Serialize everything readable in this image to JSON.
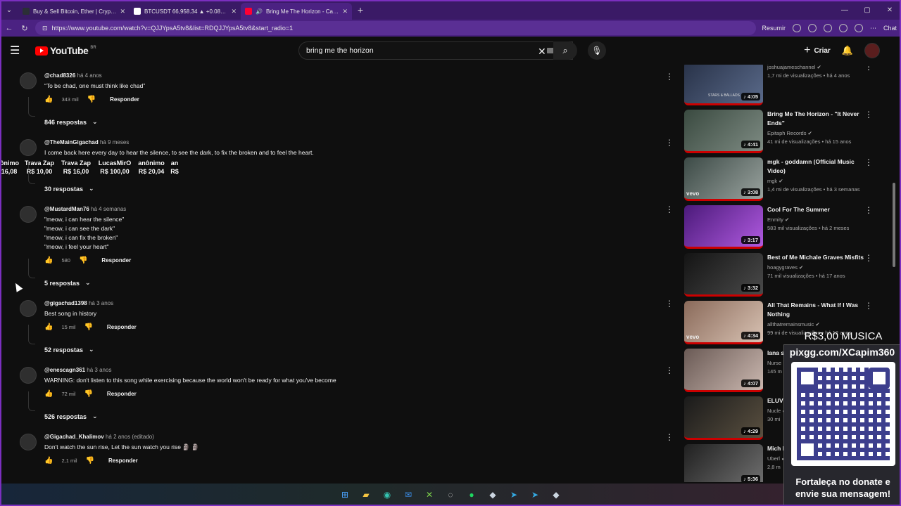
{
  "tabs": [
    {
      "label": "Buy & Sell Bitcoin, Ether | Cryptoc",
      "fav_color": "#2b2f36"
    },
    {
      "label": "BTCUSDT 66,958.34 ▲ +0.08% Unna",
      "fav_color": "#ffffff"
    },
    {
      "label": "Bring Me The Horizon - Can You",
      "fav_color": "#ff0033"
    }
  ],
  "address": {
    "url": "https://www.youtube.com/watch?v=QJJYpsA5tv8&list=RDQJJYpsA5tv8&start_radio=1",
    "resumir": "Resumir",
    "chat": "Chat"
  },
  "header": {
    "logo": "YouTube",
    "country": "BR",
    "search_value": "bring me the horizon",
    "create": "Criar"
  },
  "comments": [
    {
      "user": "@chad8326",
      "time": "há 4 anos",
      "text": [
        "“To be chad, one must think like chad”"
      ],
      "likes": "343 mil",
      "reply": "Responder",
      "replies": "846 respostas"
    },
    {
      "user": "@TheMainGigachad",
      "time": "há 9 meses",
      "text": [
        "I come back here every day to hear the silence, to see the dark, to fix the broken and to feel the heart."
      ],
      "likes": "",
      "reply": "",
      "replies": "30 respostas"
    },
    {
      "user": "@MustardMan76",
      "time": "há 4 semanas",
      "text": [
        "\"meow, i can hear the silence\"",
        "\"meow, i can see the dark\"",
        "\"meow, i can fix the broken\"",
        "\"meow, i feel your heart\""
      ],
      "likes": "580",
      "reply": "Responder",
      "replies": "5 respostas"
    },
    {
      "user": "@gigachad1398",
      "time": "há 3 anos",
      "text": [
        "Best song in history"
      ],
      "likes": "15 mil",
      "reply": "Responder",
      "replies": "52 respostas"
    },
    {
      "user": "@enescagn361",
      "time": "há 3 anos",
      "text": [
        "WARNING: don't listen to this song while exercising because the world won't be ready for what you've become"
      ],
      "likes": "72 mil",
      "reply": "Responder",
      "replies": "526 respostas"
    },
    {
      "user": "@Gigachad_Khalimov",
      "time": "há 2 anos (editado)",
      "text": [
        "Don't watch the sun rise, Let the sun watch you rise 🗿 🗿"
      ],
      "likes": "2,1 mil",
      "reply": "Responder",
      "replies": ""
    }
  ],
  "ticker": [
    {
      "name": "ônimo",
      "amount": "16,08"
    },
    {
      "name": "Trava Zap",
      "amount": "R$ 10,00"
    },
    {
      "name": "Trava Zap",
      "amount": "R$ 16,00"
    },
    {
      "name": "LucasMirO",
      "amount": "R$ 100,00"
    },
    {
      "name": "anônimo",
      "amount": "R$ 20,04"
    },
    {
      "name": "an",
      "amount": "R$"
    }
  ],
  "sidebar": [
    {
      "title": "",
      "channel": "joshuajameschannel",
      "meta": "1,7 mi de visualizações • há 4 anos",
      "duration": "4:05",
      "thumb": [
        "#283248",
        "#5a6a8a"
      ],
      "vevo": false,
      "thumb_text": "STARS & BALLADS"
    },
    {
      "title": "Bring Me The Horizon - \"It Never Ends\"",
      "channel": "Epitaph Records",
      "meta": "41 mi de visualizações • há 15 anos",
      "duration": "4:41",
      "thumb": [
        "#3a4a40",
        "#7e8b83"
      ],
      "vevo": false,
      "thumb_text": ""
    },
    {
      "title": "mgk - goddamn (Official Music Video)",
      "channel": "mgk",
      "meta": "1,4 mi de visualizações • há 3 semanas",
      "duration": "3:08",
      "thumb": [
        "#3c4a46",
        "#9aa39f"
      ],
      "vevo": true,
      "thumb_text": ""
    },
    {
      "title": "Cool For The Summer",
      "channel": "Enmity",
      "meta": "583 mil visualizações • há 2 meses",
      "duration": "3:17",
      "thumb": [
        "#4b1a7a",
        "#b05ae0"
      ],
      "vevo": false,
      "thumb_text": ""
    },
    {
      "title": "Best of Me Michale Graves Misfits",
      "channel": "hoagygraves",
      "meta": "71 mil visualizações • há 17 anos",
      "duration": "3:32",
      "thumb": [
        "#141414",
        "#4a4a4a"
      ],
      "vevo": false,
      "thumb_text": ""
    },
    {
      "title": "All That Remains - What If I Was Nothing",
      "channel": "allthatremainsmusic",
      "meta": "99 mi de visualizações • há 12 anos",
      "duration": "4:34",
      "thumb": [
        "#8a6a5a",
        "#d8c2b3"
      ],
      "vevo": true,
      "thumb_text": ""
    },
    {
      "title": "lana sadn",
      "channel": "Nurse",
      "meta": "145 m",
      "duration": "4:07",
      "thumb": [
        "#6a5a55",
        "#cbb8b0"
      ],
      "vevo": false,
      "thumb_text": ""
    },
    {
      "title": "ELUV (OFF",
      "channel": "Nucle",
      "meta": "30 mi",
      "duration": "4:29",
      "thumb": [
        "#1a1a1a",
        "#5a5040"
      ],
      "vevo": false,
      "thumb_text": ""
    },
    {
      "title": "Mich bone",
      "channel": "Uberl",
      "meta": "2,8 m",
      "duration": "5:36",
      "thumb": [
        "#202020",
        "#707070"
      ],
      "vevo": false,
      "thumb_text": ""
    }
  ],
  "overlay": {
    "price": "R$3,00 MUSICA",
    "url": "pixgg.com/XCapim360",
    "message": "Fortaleça no donate e envie sua mensagem!"
  },
  "colors": {
    "accent": "#7b2fbf",
    "youtube_red": "#ff0000",
    "progress_red": "#cc0000"
  }
}
